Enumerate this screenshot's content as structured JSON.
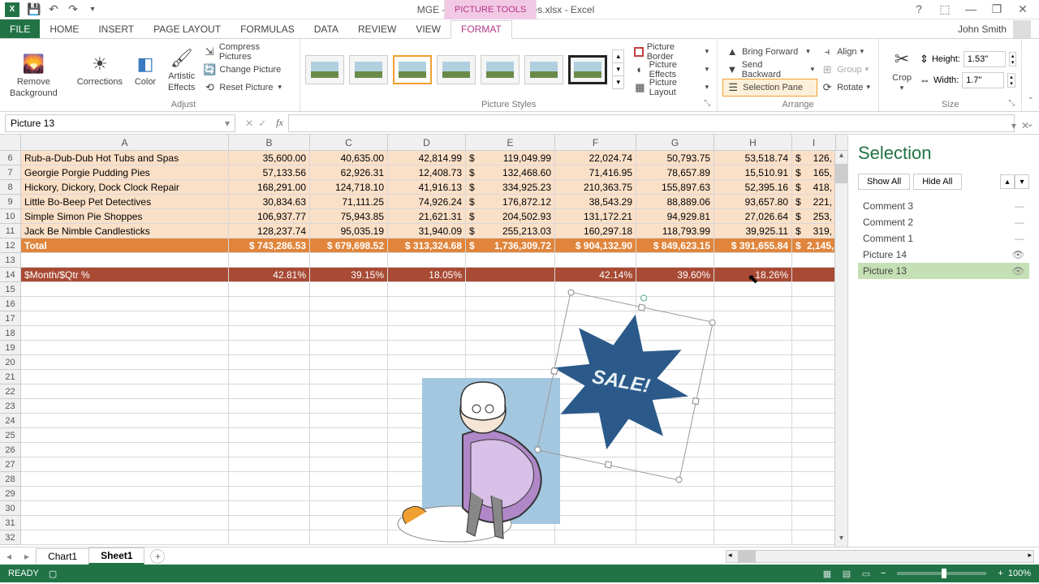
{
  "app": {
    "title": "MGE -2013 YTD and Images.xlsx - Excel",
    "context_tab": "PICTURE TOOLS"
  },
  "window_controls": {
    "help": "?",
    "full": "⬚",
    "min": "—",
    "restore": "❐",
    "close": "✕"
  },
  "tabs": {
    "file": "FILE",
    "home": "HOME",
    "insert": "INSERT",
    "page_layout": "PAGE LAYOUT",
    "formulas": "FORMULAS",
    "data": "DATA",
    "review": "REVIEW",
    "view": "VIEW",
    "format": "FORMAT"
  },
  "user": {
    "name": "John Smith"
  },
  "ribbon": {
    "remove_bg": "Remove\nBackground",
    "corrections": "Corrections",
    "color": "Color",
    "artistic": "Artistic\nEffects",
    "compress": "Compress Pictures",
    "change": "Change Picture",
    "reset": "Reset Picture",
    "adjust": "Adjust",
    "picture_styles": "Picture Styles",
    "picture_border": "Picture Border",
    "picture_effects": "Picture Effects",
    "picture_layout": "Picture Layout",
    "bring_forward": "Bring Forward",
    "send_backward": "Send Backward",
    "selection_pane": "Selection Pane",
    "align": "Align",
    "group": "Group",
    "rotate": "Rotate",
    "arrange": "Arrange",
    "crop": "Crop",
    "height_label": "Height:",
    "width_label": "Width:",
    "height_val": "1.53\"",
    "width_val": "1.7\"",
    "size": "Size"
  },
  "name_box": "Picture 13",
  "columns": [
    "A",
    "B",
    "C",
    "D",
    "E",
    "F",
    "G",
    "H",
    "I"
  ],
  "rows": [
    {
      "n": 6,
      "cls": "orange-light",
      "a": "Rub-a-Dub-Dub Hot Tubs and Spas",
      "b": "35,600.00",
      "c": "40,635.00",
      "d": "42,814.99",
      "e": "$",
      "ev": "119,049.99",
      "f": "22,024.74",
      "g": "50,793.75",
      "h": "53,518.74",
      "i": "$",
      "iv": "126,"
    },
    {
      "n": 7,
      "cls": "orange-light",
      "a": "Georgie Porgie Pudding Pies",
      "b": "57,133.56",
      "c": "62,926.31",
      "d": "12,408.73",
      "e": "$",
      "ev": "132,468.60",
      "f": "71,416.95",
      "g": "78,657.89",
      "h": "15,510.91",
      "i": "$",
      "iv": "165,"
    },
    {
      "n": 8,
      "cls": "orange-light",
      "a": "Hickory, Dickory,  Dock Clock Repair",
      "b": "168,291.00",
      "c": "124,718.10",
      "d": "41,916.13",
      "e": "$",
      "ev": "334,925.23",
      "f": "210,363.75",
      "g": "155,897.63",
      "h": "52,395.16",
      "i": "$",
      "iv": "418,"
    },
    {
      "n": 9,
      "cls": "orange-light",
      "a": "Little Bo-Beep Pet Detectives",
      "b": "30,834.63",
      "c": "71,111.25",
      "d": "74,926.24",
      "e": "$",
      "ev": "176,872.12",
      "f": "38,543.29",
      "g": "88,889.06",
      "h": "93,657.80",
      "i": "$",
      "iv": "221,"
    },
    {
      "n": 10,
      "cls": "orange-light",
      "a": "Simple Simon Pie Shoppes",
      "b": "106,937.77",
      "c": "75,943.85",
      "d": "21,621.31",
      "e": "$",
      "ev": "204,502.93",
      "f": "131,172.21",
      "g": "94,929.81",
      "h": "27,026.64",
      "i": "$",
      "iv": "253,"
    },
    {
      "n": 11,
      "cls": "orange-light",
      "a": "Jack Be Nimble Candlesticks",
      "b": "128,237.74",
      "c": "95,035.19",
      "d": "31,940.09",
      "e": "$",
      "ev": "255,213.03",
      "f": "160,297.18",
      "g": "118,793.99",
      "h": "39,925.11",
      "i": "$",
      "iv": "319,"
    }
  ],
  "total_row": {
    "n": 12,
    "a": "Total",
    "b": "$ 743,286.53",
    "c": "$ 679,698.52",
    "d": "$ 313,324.68",
    "e": "$",
    "ev": "1,736,309.72",
    "f": "$ 904,132.90",
    "g": "$ 849,623.15",
    "h": "$ 391,655.84",
    "i": "$",
    "iv": "2,145,"
  },
  "pct_row": {
    "n": 14,
    "a": "$Month/$Qtr %",
    "b": "42.81%",
    "c": "39.15%",
    "d": "18.05%",
    "e": "",
    "ev": "",
    "f": "42.14%",
    "g": "39.60%",
    "h": "18.26%",
    "i": "",
    "iv": ""
  },
  "empty_rows_after": [
    13,
    15,
    16,
    17,
    18,
    19,
    20,
    21,
    22,
    23,
    24,
    25,
    26,
    27,
    28,
    29,
    30,
    31,
    32
  ],
  "sale_text": "SALE!",
  "selection": {
    "title": "Selection",
    "show_all": "Show All",
    "hide_all": "Hide All",
    "items": [
      {
        "label": "Comment 3",
        "vis": "line"
      },
      {
        "label": "Comment 2",
        "vis": "line"
      },
      {
        "label": "Comment 1",
        "vis": "line"
      },
      {
        "label": "Picture 14",
        "vis": "eye"
      },
      {
        "label": "Picture 13",
        "vis": "eye",
        "active": true
      }
    ]
  },
  "sheets": {
    "chart1": "Chart1",
    "sheet1": "Sheet1"
  },
  "status": {
    "ready": "READY",
    "zoom": "100%"
  }
}
